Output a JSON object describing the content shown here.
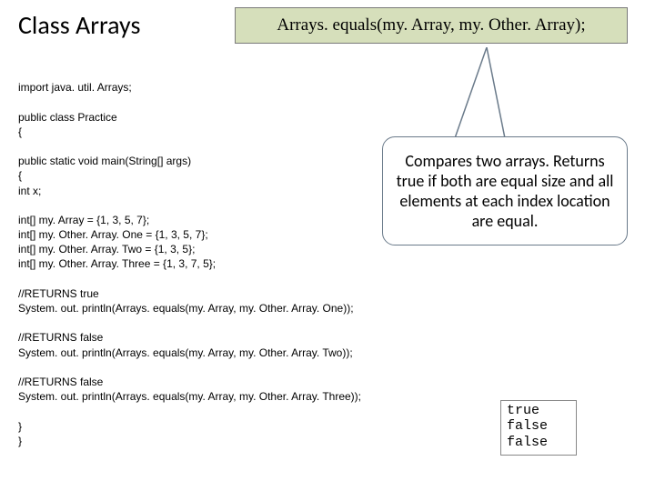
{
  "title": "Class Arrays",
  "method_signature": "Arrays. equals(my. Array, my. Other. Array);",
  "callout_text": "Compares two arrays.  Returns true if both are equal size and all elements at each index location are equal.",
  "code_lines": {
    "l1": "import java. util. Arrays;",
    "l2": "",
    "l3": "public class Practice",
    "l4": "{",
    "l5": "",
    "l6": "public static void main(String[] args)",
    "l7": "{",
    "l8": "int x;",
    "l9": "",
    "l10": "int[] my. Array = {1, 3, 5, 7};",
    "l11": "int[] my. Other. Array. One = {1, 3, 5, 7};",
    "l12": "int[] my. Other. Array. Two = {1, 3, 5};",
    "l13": "int[] my. Other. Array. Three = {1, 3, 7, 5};",
    "l14": "",
    "l15": "//RETURNS true",
    "l16": "System. out. println(Arrays. equals(my. Array, my. Other. Array. One));",
    "l17": "",
    "l18": "//RETURNS false",
    "l19": "System. out. println(Arrays. equals(my. Array, my. Other. Array. Two));",
    "l20": "",
    "l21": "//RETURNS false",
    "l22": "System. out. println(Arrays. equals(my. Array, my. Other. Array. Three));",
    "l23": "",
    "l24": "}",
    "l25": "}"
  },
  "output": "true\nfalse\nfalse"
}
